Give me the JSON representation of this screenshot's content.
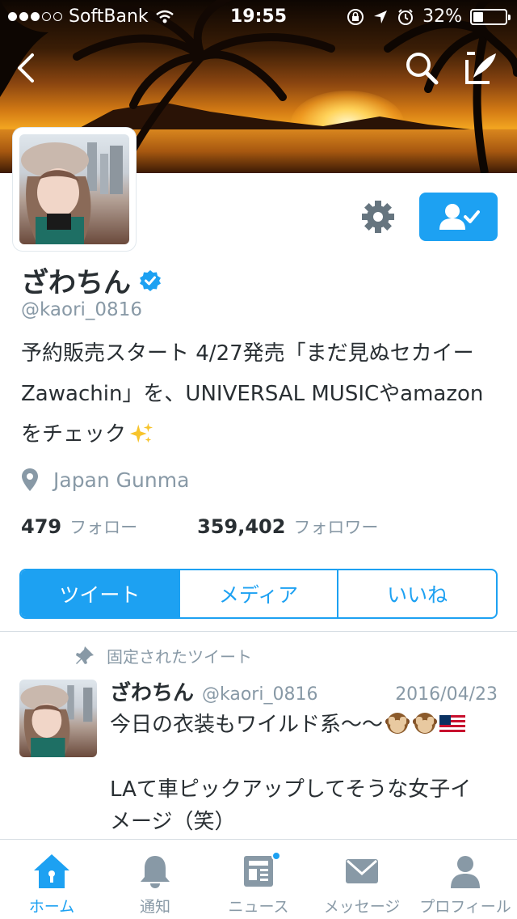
{
  "status_bar": {
    "carrier": "SoftBank",
    "time": "19:55",
    "battery": "32%",
    "battery_level": 0.32
  },
  "profile": {
    "name": "ざわちん",
    "handle": "@kaori_0816",
    "bio_lines": [
      "予約販売スタート 4/27発売「まだ見ぬセカイー",
      "Zawachin」を、UNIVERSAL MUSICやamazon",
      "をチェック"
    ],
    "location": "Japan Gunma",
    "following_count": "479",
    "following_label": "フォロー",
    "followers_count": "359,402",
    "followers_label": "フォロワー"
  },
  "tabs": [
    {
      "label": "ツイート",
      "active": true
    },
    {
      "label": "メディア",
      "active": false
    },
    {
      "label": "いいね",
      "active": false
    }
  ],
  "pinned_tweet": {
    "pinned_label": "固定されたツイート",
    "name": "ざわちん",
    "handle": "@kaori_0816",
    "date": "2016/04/23",
    "line1": "今日の衣装もワイルド系〜〜",
    "line2": "LAて車ピックアップしてそうな女子イ",
    "line3": "メージ（笑）"
  },
  "bottom_nav": [
    {
      "label": "ホーム",
      "icon": "home-icon",
      "active": true
    },
    {
      "label": "通知",
      "icon": "bell-icon",
      "active": false
    },
    {
      "label": "ニュース",
      "icon": "news-icon",
      "active": false
    },
    {
      "label": "メッセージ",
      "icon": "mail-icon",
      "active": false
    },
    {
      "label": "プロフィール",
      "icon": "person-icon",
      "active": false
    }
  ],
  "colors": {
    "accent": "#1da1f2",
    "text": "#292f33",
    "muted": "#8899a6"
  }
}
